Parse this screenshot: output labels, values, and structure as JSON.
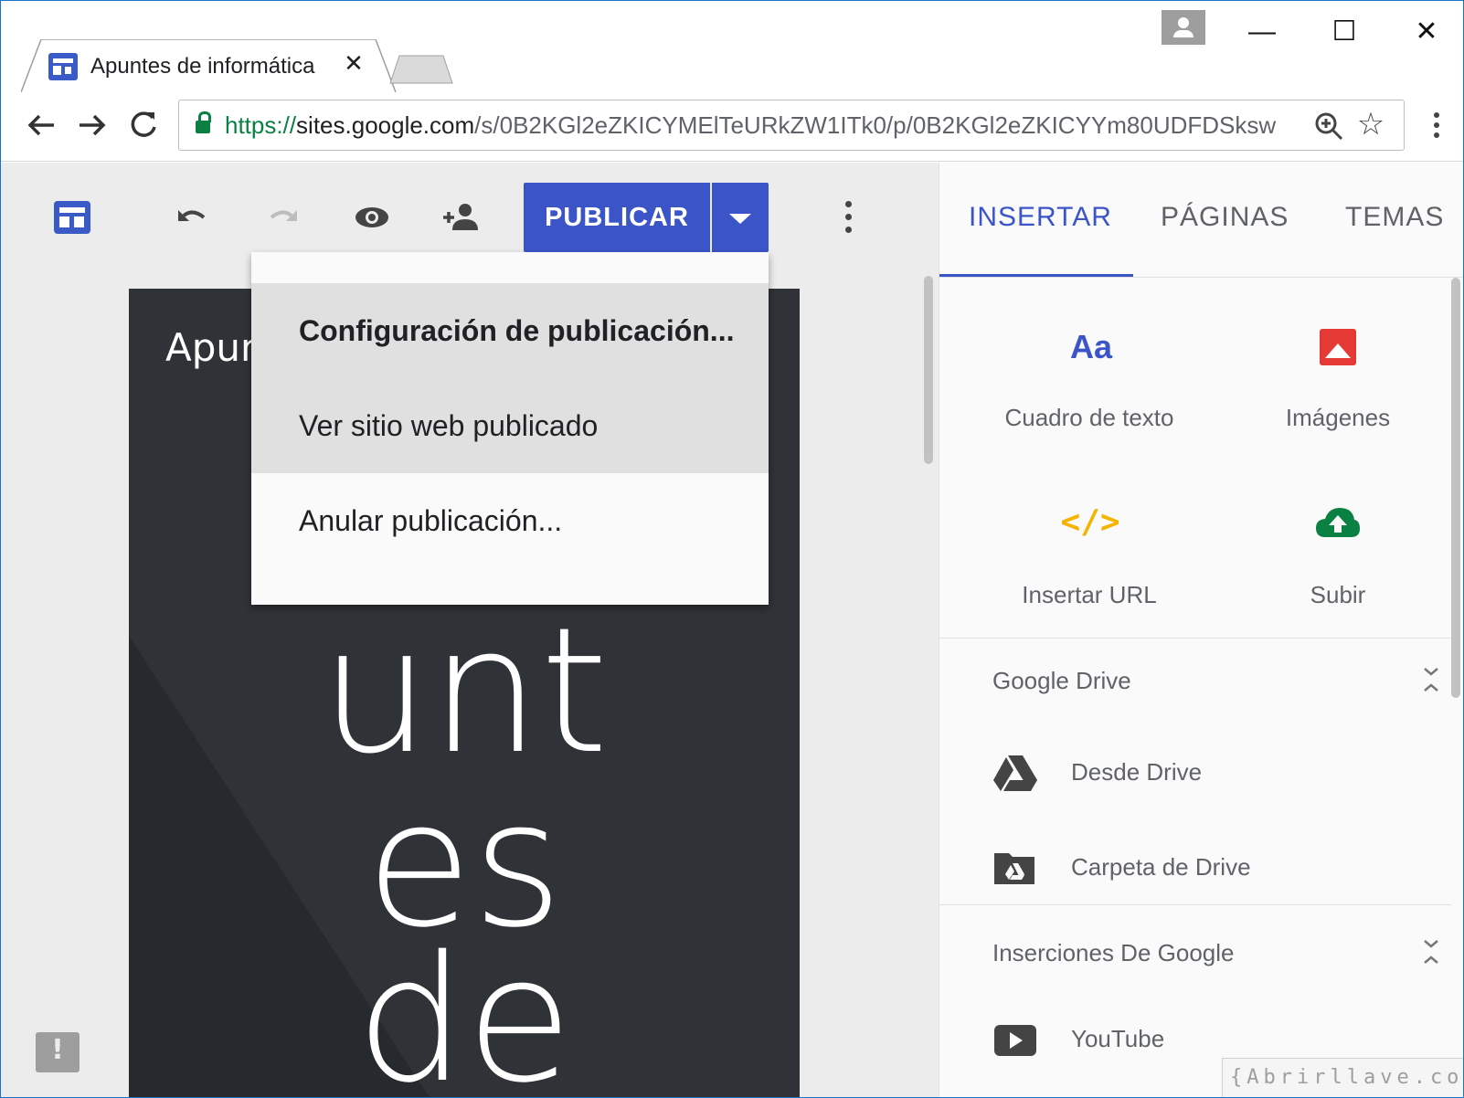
{
  "browser": {
    "tab_title": "Apuntes de informática",
    "tab_close": "✕",
    "url_scheme": "https://",
    "url_host": "sites.google.com",
    "url_path": "/s/0B2KGl2eZKICYMElTeURkZW1ITk0/p/0B2KGl2eZKICYYm80UDFDSksw",
    "icons": [
      "back-icon",
      "forward-icon",
      "reload-icon",
      "lock-icon",
      "zoom-icon",
      "star-icon",
      "menu-icon"
    ],
    "window_controls": {
      "minimize": "—",
      "maximize": "☐",
      "close": "✕"
    }
  },
  "toolbar": {
    "publish_label": "PUBLICAR",
    "icons": [
      "sites-logo-icon",
      "undo-icon",
      "redo-icon",
      "preview-icon",
      "add-person-icon",
      "dropdown-arrow-icon",
      "more-vert-icon"
    ]
  },
  "publish_menu": {
    "items": [
      {
        "label": "Configuración de publicación..."
      },
      {
        "label": "Ver sitio web publicado"
      },
      {
        "label": "Anular publicación..."
      }
    ]
  },
  "preview": {
    "small_title": "Apun",
    "big_lines": [
      "unt",
      "es",
      "de"
    ],
    "bg_color": "#2f3237"
  },
  "panel": {
    "tabs": [
      {
        "label": "INSERTAR",
        "active": true
      },
      {
        "label": "PÁGINAS",
        "active": false
      },
      {
        "label": "TEMAS",
        "active": false
      }
    ],
    "tiles": [
      {
        "label": "Cuadro de texto",
        "icon_text": "Aa",
        "icon": "text-box-icon"
      },
      {
        "label": "Imágenes",
        "icon": "image-icon"
      },
      {
        "label": "Insertar URL",
        "icon_text": "</>",
        "icon": "embed-code-icon"
      },
      {
        "label": "Subir",
        "icon": "cloud-upload-icon"
      }
    ],
    "sections": [
      {
        "title": "Google Drive",
        "items": [
          {
            "label": "Desde Drive",
            "icon": "drive-icon"
          },
          {
            "label": "Carpeta de Drive",
            "icon": "drive-folder-icon"
          }
        ]
      },
      {
        "title": "Inserciones De Google",
        "items": [
          {
            "label": "YouTube",
            "icon": "youtube-icon"
          }
        ]
      }
    ]
  },
  "colors": {
    "accent": "#3b55c9",
    "secure": "#0b8043",
    "image": "#e53935",
    "embed": "#f5b400",
    "upload": "#0b8043"
  },
  "watermark": "{Abrirllave.com"
}
